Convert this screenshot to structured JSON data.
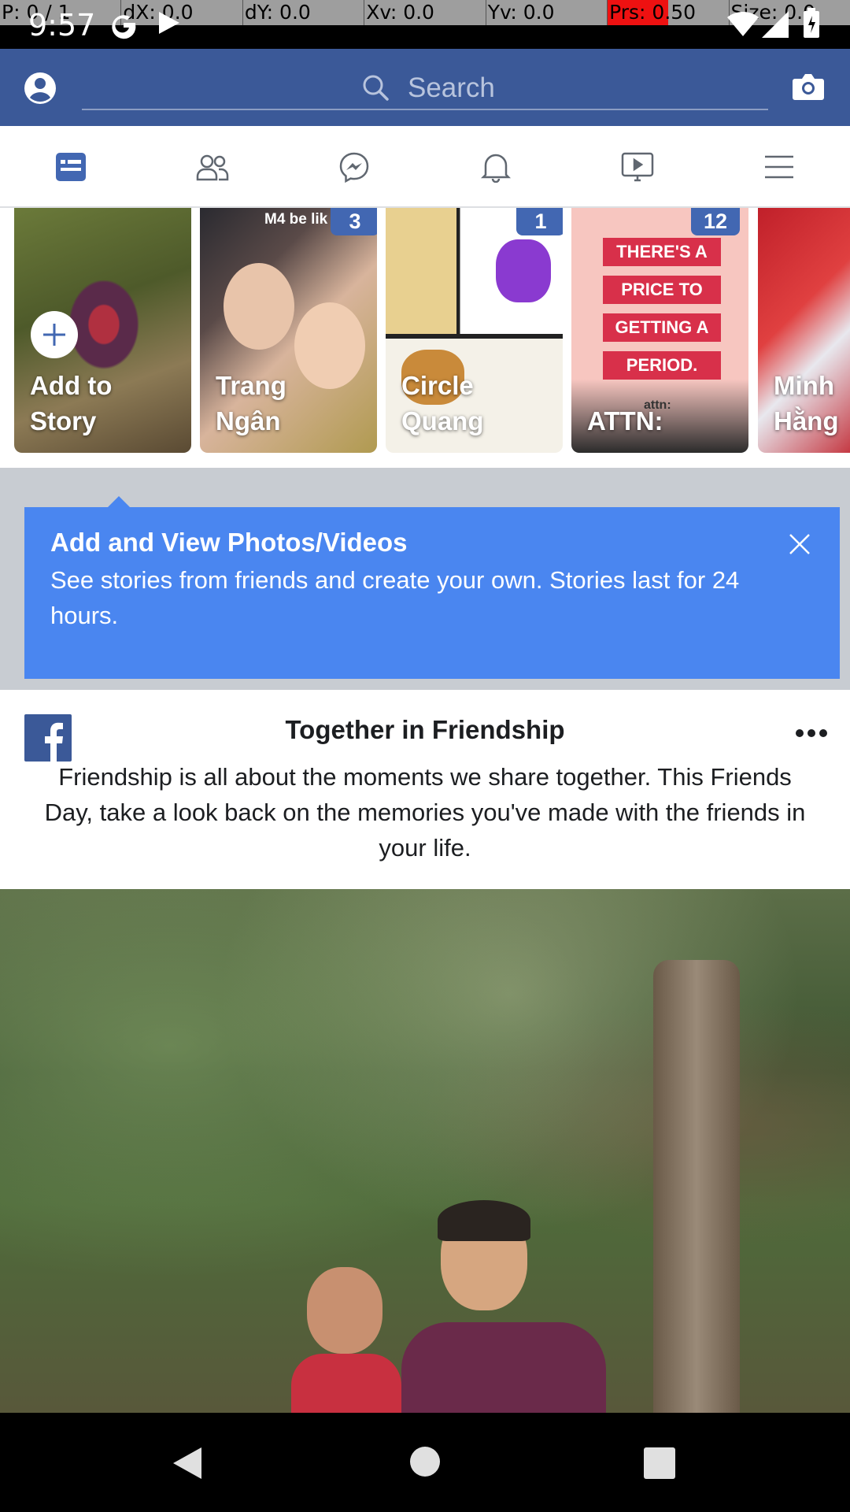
{
  "debug_bar": {
    "pointer": "P: 0 / 1",
    "dx": "dX: 0.0",
    "dy": "dY: 0.0",
    "xv": "Xv: 0.0",
    "yv": "Yv: 0.0",
    "prs": "Prs: 0.50",
    "size": "Size: 0.0"
  },
  "status_bar": {
    "time": "9:57",
    "icons": [
      "google-g-icon",
      "play-icon",
      "wifi-icon",
      "signal-icon",
      "battery-icon"
    ]
  },
  "header": {
    "search_placeholder": "Search",
    "brand_color": "#3b5998"
  },
  "tabs": [
    {
      "name": "news-feed",
      "icon": "news-feed-icon",
      "active": true
    },
    {
      "name": "friends",
      "icon": "friends-icon",
      "active": false
    },
    {
      "name": "messenger",
      "icon": "messenger-icon",
      "active": false
    },
    {
      "name": "notifications",
      "icon": "bell-icon",
      "active": false
    },
    {
      "name": "watch",
      "icon": "video-icon",
      "active": false
    },
    {
      "name": "menu",
      "icon": "hamburger-icon",
      "active": false
    }
  ],
  "stories": [
    {
      "name_line1": "Add to",
      "name_line2": "Story",
      "badge": ""
    },
    {
      "name_line1": "Trang",
      "name_line2": "Ngân",
      "badge": "3",
      "caption": "M4 be lik"
    },
    {
      "name_line1": "Circle",
      "name_line2": "Quang",
      "badge": "1"
    },
    {
      "name_line1": "",
      "name_line2": "ATTN:",
      "badge": "12",
      "poster_lines": [
        "THERE'S A",
        "PRICE TO",
        "GETTING A",
        "PERIOD."
      ],
      "small_text": "attn:"
    },
    {
      "name_line1": "Minh",
      "name_line2": "Hằng",
      "badge": ""
    }
  ],
  "tip": {
    "title": "Add and View Photos/Videos",
    "body": "See stories from friends and create your own. Stories last for 24 hours."
  },
  "post": {
    "title": "Together in Friendship",
    "text": "Friendship is all about the moments we share together. This Friends Day, take a look back on the memories you've made with the friends in your life."
  }
}
